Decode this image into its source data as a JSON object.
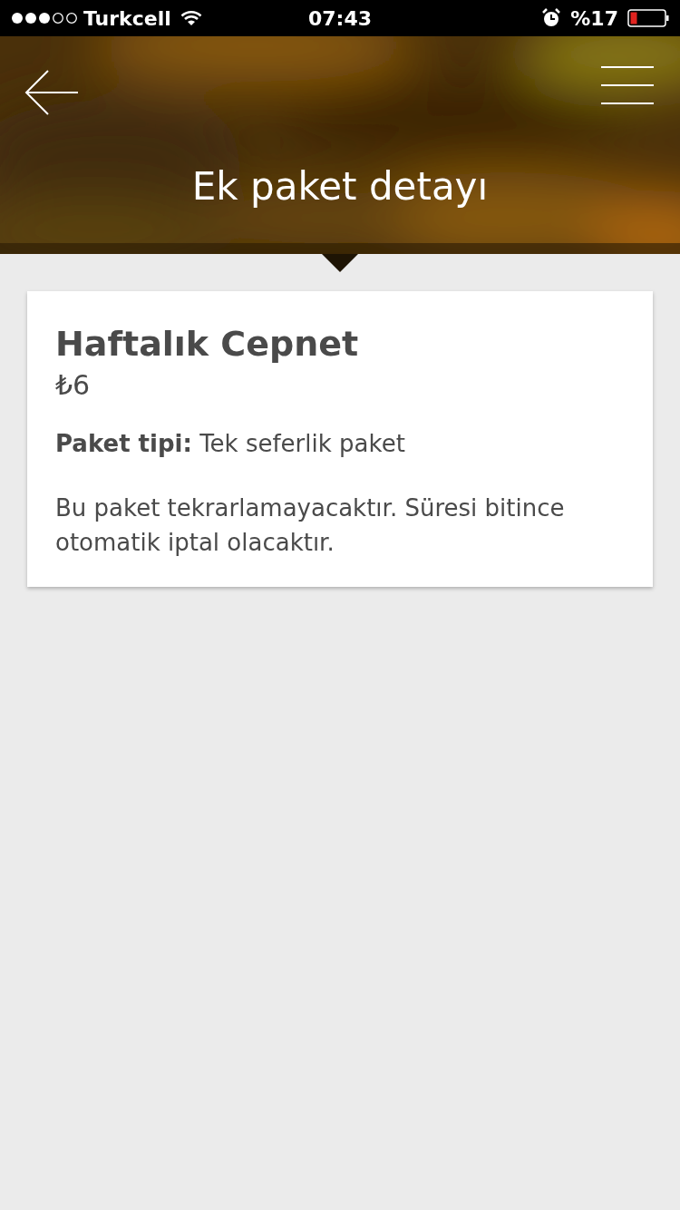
{
  "status_bar": {
    "carrier": "Turkcell",
    "time": "07:43",
    "battery_percent": "%17"
  },
  "header": {
    "title": "Ek paket detayı"
  },
  "card": {
    "name": "Haftalık Cepnet",
    "price": "₺6",
    "type_line": "**Paket tipi:** Tek seferlik paket",
    "description": "Bu paket tekrarlamayacaktır. Süresi bitince otomatik iptal olacaktır."
  }
}
